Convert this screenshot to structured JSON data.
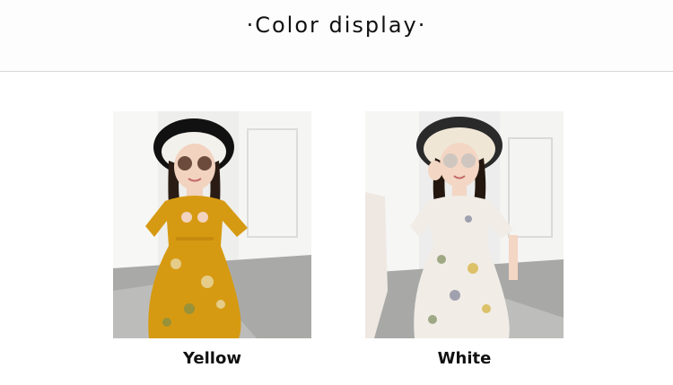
{
  "header": {
    "title": "·Color display·"
  },
  "colors": {
    "yellow_dress": "#d69a12",
    "white_dress": "#f1ece6",
    "background": "#ffffff",
    "divider": "#d8d8d8"
  },
  "variants": [
    {
      "label": "Yellow",
      "image": "girl-in-yellow-floral-dress-photo"
    },
    {
      "label": "White",
      "image": "girl-in-white-floral-dress-photo"
    }
  ]
}
